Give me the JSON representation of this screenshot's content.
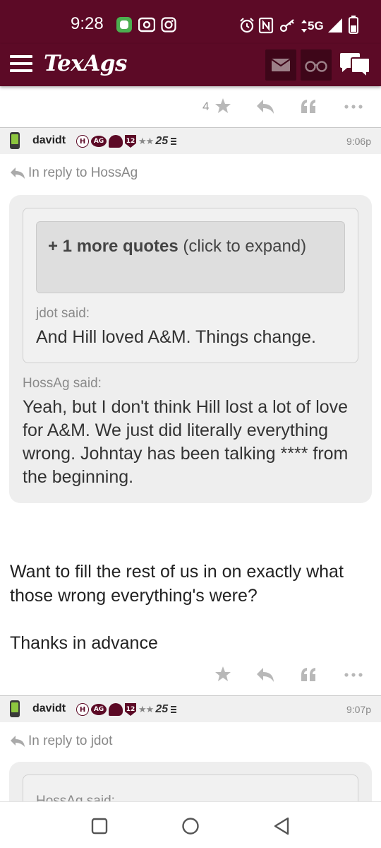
{
  "status_bar": {
    "time": "9:28",
    "network": "5G"
  },
  "app_bar": {
    "logo": "TexAgs",
    "icons": [
      "menu-icon",
      "mail-icon",
      "binoculars-icon",
      "chat-bubbles-icon"
    ]
  },
  "colors": {
    "brand_maroon": "#5c0a26",
    "header_grey": "#f0f0f0",
    "quote_bg": "#eeeeee"
  },
  "top_actions": {
    "star_count": "4"
  },
  "post1": {
    "username": "davidt",
    "badge_h": "H",
    "badge_ag": "AG",
    "badge_12": "12",
    "stars": "★★",
    "year": "25",
    "time": "9:06p",
    "reply_to": "In reply to HossAg",
    "more_quotes_bold": "+ 1 more quotes",
    "more_quotes_rest": " (click to expand)",
    "inner_said": "jdot said:",
    "inner_text": "And Hill loved A&M. Things change.",
    "outer_said": "HossAg said:",
    "outer_text": "Yeah, but I don't think Hill lost a lot of love for A&M. We just did literally everything wrong. Johntay has been talking **** from the beginning.",
    "body_line1": "Want to fill the rest of us in on exactly what those wrong everything's were?",
    "body_line2": "Thanks in advance"
  },
  "post2": {
    "username": "davidt",
    "badge_h": "H",
    "badge_ag": "AG",
    "badge_12": "12",
    "stars": "★★",
    "year": "25",
    "time": "9:07p",
    "reply_to": "In reply to jdot",
    "quote_said": "HossAg said:"
  },
  "nav": {
    "icons": [
      "recents-square-icon",
      "home-circle-icon",
      "back-triangle-icon"
    ]
  }
}
